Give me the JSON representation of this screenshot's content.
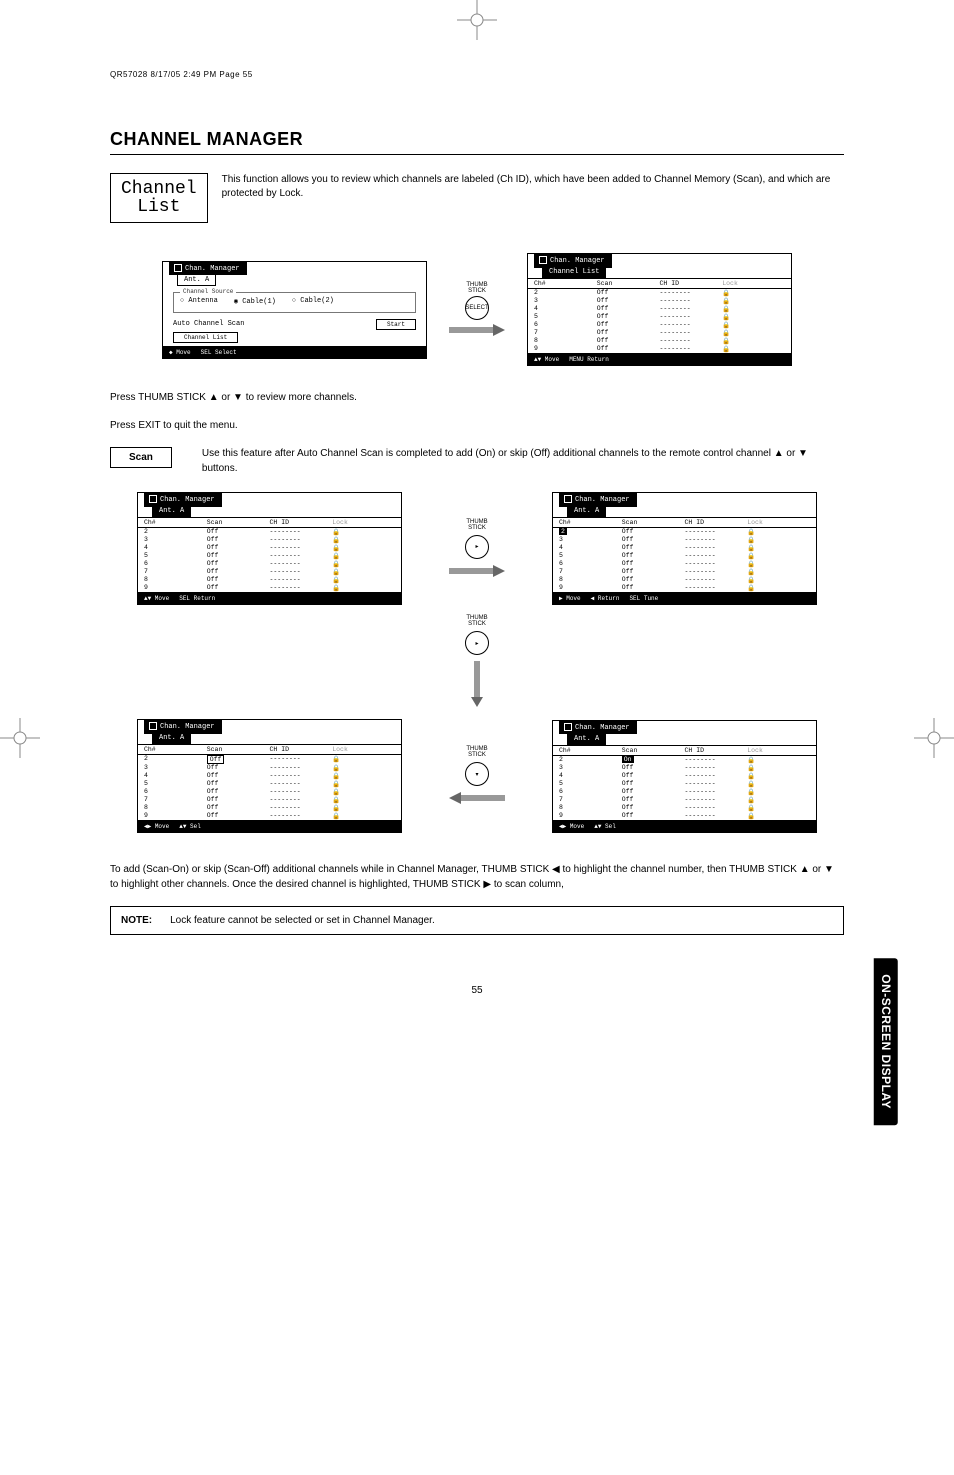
{
  "header_line": "QR57028  8/17/05  2:49 PM  Page 55",
  "section_title": "CHANNEL MANAGER",
  "chip_line1": "Channel",
  "chip_line2": "List",
  "intro_text": "This function allows you to review which channels are labeled (Ch ID), which have been added to Channel Memory (Scan), and which are protected by Lock.",
  "osd1": {
    "title": "Chan. Manager",
    "sub": "Ant. A",
    "group_label": "Channel Source",
    "radios": [
      "Antenna",
      "Cable(1)",
      "Cable(2)"
    ],
    "auto_label": "Auto Channel Scan",
    "start": "Start",
    "chlist_btn": "Channel List",
    "footer": [
      "◆ Move",
      "SEL Select"
    ]
  },
  "thumb_label": "THUMB\nSTICK",
  "knob_select": "SELECT",
  "osd2": {
    "title": "Chan. Manager",
    "sub": "Channel List",
    "columns": [
      "Ch#",
      "Scan",
      "CH ID",
      "Lock"
    ],
    "rows": [
      [
        "2",
        "Off",
        "--------",
        "🔒"
      ],
      [
        "3",
        "Off",
        "--------",
        "🔒"
      ],
      [
        "4",
        "Off",
        "--------",
        "🔒"
      ],
      [
        "5",
        "Off",
        "--------",
        "🔒"
      ],
      [
        "6",
        "Off",
        "--------",
        "🔒"
      ],
      [
        "7",
        "Off",
        "--------",
        "🔒"
      ],
      [
        "8",
        "Off",
        "--------",
        "🔒"
      ],
      [
        "9",
        "Off",
        "--------",
        "🔒"
      ]
    ],
    "footer": [
      "▲▼ Move",
      "MENU Return"
    ]
  },
  "press_line1": "Press THUMB STICK ▲ or ▼ to review more channels.",
  "press_line2": "Press EXIT to quit the menu.",
  "scan_label": "Scan",
  "scan_text": "Use this feature after Auto Channel Scan is completed to add (On) or skip (Off) additional channels to the remote control channel ▲ or ▼ buttons.",
  "osd_scan": {
    "title": "Chan. Manager",
    "sub": "Ant. A",
    "columns": [
      "Ch#",
      "Scan",
      "CH ID",
      "Lock"
    ],
    "rows_a": [
      [
        "2",
        "Off",
        "--------",
        "🔒"
      ],
      [
        "3",
        "Off",
        "--------",
        "🔒"
      ],
      [
        "4",
        "Off",
        "--------",
        "🔒"
      ],
      [
        "5",
        "Off",
        "--------",
        "🔒"
      ],
      [
        "6",
        "Off",
        "--------",
        "🔒"
      ],
      [
        "7",
        "Off",
        "--------",
        "🔒"
      ],
      [
        "8",
        "Off",
        "--------",
        "🔒"
      ],
      [
        "9",
        "Off",
        "--------",
        "🔒"
      ]
    ],
    "footer_a": [
      "▲▼ Move",
      "SEL Return"
    ],
    "footer_b": [
      "▶ Move",
      "◀ Return",
      "SEL Tune"
    ],
    "footer_c": [
      "◀▶ Move",
      "▲▼ Sel"
    ],
    "footer_d": [
      "◀▶ Move",
      "▲▼ Sel"
    ]
  },
  "bottom_para": "To add (Scan-On) or skip (Scan-Off) additional channels while in Channel Manager, THUMB STICK ◀ to highlight the channel number, then THUMB STICK ▲ or ▼ to highlight other channels.  Once the desired channel is highlighted, THUMB STICK ▶ to scan column,",
  "note_label": "NOTE:",
  "note_text": "Lock feature cannot be selected or set in Channel Manager.",
  "side_tab": "ON-SCREEN DISPLAY",
  "page_num": "55"
}
